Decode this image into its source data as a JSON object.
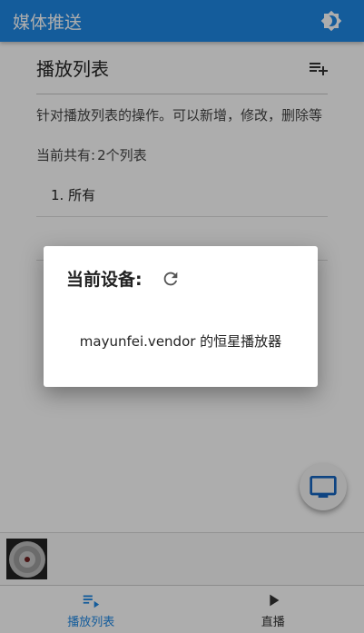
{
  "header": {
    "title": "媒体推送",
    "settings_icon": "brightness-icon"
  },
  "playlist": {
    "title": "播放列表",
    "add_icon": "playlist-add-icon",
    "description": "针对播放列表的操作。可以新增，修改，删除等",
    "count_label": "当前共有:",
    "count_value": "2个列表",
    "items": [
      {
        "label": "1. 所有"
      },
      {
        "label": ""
      }
    ]
  },
  "fab": {
    "icon": "monitor-icon"
  },
  "mini_player": {
    "icon": "disc-icon"
  },
  "bottom_nav": {
    "items": [
      {
        "label": "播放列表",
        "icon": "playlist-icon",
        "active": true
      },
      {
        "label": "直播",
        "icon": "play-icon",
        "active": false
      }
    ]
  },
  "dialog": {
    "title": "当前设备:",
    "refresh_icon": "refresh-icon",
    "body": "mayunfei.vendor 的恒星播放器"
  },
  "colors": {
    "primary": "#1e88e5",
    "scrim": "rgba(0,0,0,0.32)"
  }
}
